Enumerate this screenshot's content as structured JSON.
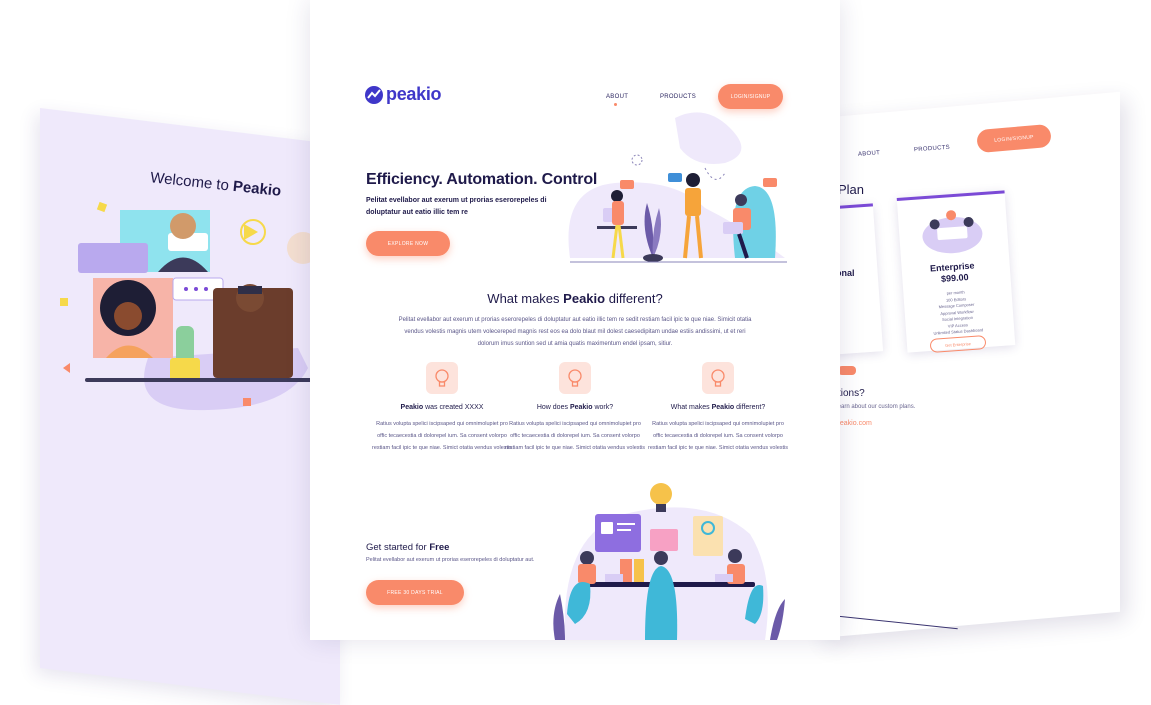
{
  "colors": {
    "brand": "#3f37c9",
    "accent": "#f98a6a",
    "text": "#1f1a4a",
    "muted": "#5a5688",
    "lavender": "#efe9fb",
    "purple": "#7b4ad6"
  },
  "left_page": {
    "title_prefix": "Welcome to",
    "title_brand": "Peakio"
  },
  "main": {
    "logo": {
      "icon": "peak-chart-icon",
      "text": "peakio"
    },
    "nav": {
      "about": "ABOUT",
      "products": "PRODUCTS",
      "login": "LOGIN/SIGNUP"
    },
    "hero": {
      "title": "Efficiency. Automation. Control",
      "subtitle": "Pelitat evellabor aut exerum ut prorias eserorepeles di doluptatur aut eatio illic tem re",
      "cta": "EXPLORE NOW"
    },
    "section": {
      "title_prefix": "What makes",
      "title_brand": "Peakio",
      "title_suffix": "different?",
      "para": "Pelitat evellabor aut exerum ut prorias eserorepeles di doluptatur aut eatio illic tem re sedit restiam facil ipic te que niae. Simicit otatia vendus volestis magnis utem volecereped magnis rest eos ea dolo blaut mil dolest caesedipitam undae estiis andissimi, ut et reri dolorum imus suntion sed ut amia quatis maximentum endel ipsam, sitiur."
    },
    "features": [
      {
        "icon": "lightbulb-icon",
        "brand": "Peakio",
        "rest": "was created XXXX",
        "desc": "Ratius volupta spelici iscipsaped qui omnimolupiet pro offic tecaecestia di dolorepel ium. Sa consent volorpo  restiam facil ipic te que niae. Simict otatia vendus volestis"
      },
      {
        "icon": "lightbulb-icon",
        "pre": "How does",
        "brand": "Peakio",
        "rest": "work?",
        "desc": "Ratius volupta spelici iscipsaped qui omnimolupiet pro offic tecaecestia di dolorepel ium. Sa consent volorpo  restiam facil ipic te que niae. Simict otatia vendus volestis"
      },
      {
        "icon": "lightbulb-icon",
        "pre": "What makes",
        "brand": "Peakio",
        "rest": "different?",
        "desc": "Ratius volupta spelici iscipsaped qui omnimolupiet pro offic tecaecestia di dolorepel ium. Sa consent volorpo  restiam facil ipic te que niae. Simict otatia vendus volestis"
      }
    ],
    "get_started": {
      "title_prefix": "Get started for",
      "title_bold": "Free",
      "subtitle": "Pelitat evellabor aut exerum ut prorias eserorepeles di doluptatur aut.",
      "cta": "FREE 30 DAYS TRIAL"
    }
  },
  "right_page": {
    "nav": {
      "about": "ABOUT",
      "products": "PRODUCTS",
      "login": "LOGIN/SIGNUP"
    },
    "plan_title": "Plan",
    "card_partial": "onal",
    "enterprise": {
      "name": "Enterprise",
      "price": "$99.00",
      "period": "per month",
      "features": [
        "100 Editors",
        "Message Composer",
        "Approval Workflow",
        "Social Integration",
        "VIP Access",
        "Unlimited Status Dashboard"
      ],
      "cta": "Get Enterprise"
    },
    "questions": "tions?",
    "questions_sub": "r to learn about our custom plans.",
    "email": "peakio.com"
  }
}
